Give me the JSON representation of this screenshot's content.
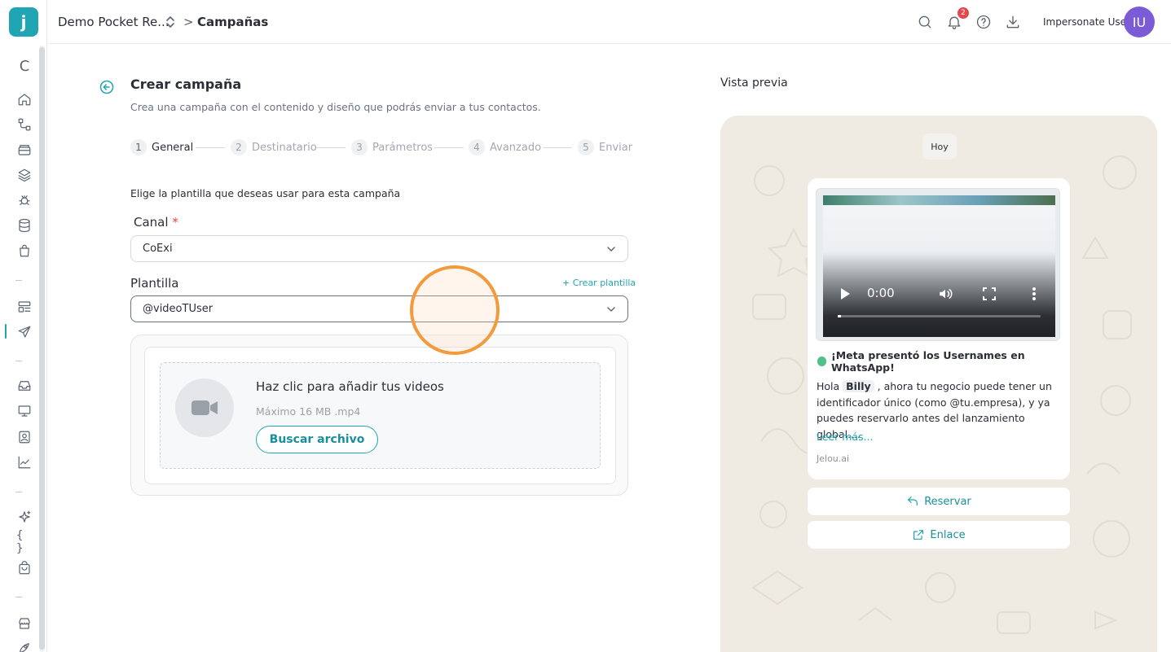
{
  "app": {
    "logo_letter": "j",
    "reload_glyph": "C"
  },
  "topbar": {
    "project": "Demo Pocket Re...",
    "separator": ">",
    "current_page": "Campañas",
    "notifications_count": "2",
    "user_name": "Impersonate User",
    "avatar_initials": "IU",
    "icons": [
      "search-icon",
      "bell-icon",
      "help-icon",
      "download-icon"
    ]
  },
  "sidebar": {
    "items": [
      "home-icon",
      "flow-icon",
      "archive-icon",
      "layers-icon",
      "bug-icon",
      "database-icon",
      "shopping-bag-icon",
      "layout-icon",
      "send-icon",
      "inbox-icon",
      "monitor-icon",
      "contact-icon",
      "chart-icon",
      "sparkles-icon",
      "braces-icon",
      "store-bag-icon",
      "shop-icon",
      "rocket-icon"
    ],
    "active": "send-icon",
    "braces_glyph": "{ }"
  },
  "form": {
    "title": "Crear campaña",
    "subtitle": "Crea una campaña con el contenido y diseño que podrás enviar a tus contactos.",
    "steps": [
      {
        "num": "1",
        "label": "General"
      },
      {
        "num": "2",
        "label": "Destinatario"
      },
      {
        "num": "3",
        "label": "Parámetros"
      },
      {
        "num": "4",
        "label": "Avanzado"
      },
      {
        "num": "5",
        "label": "Enviar"
      }
    ],
    "active_step": 1,
    "intro": "Elige la plantilla que deseas usar para esta campaña",
    "canal_label": "Canal",
    "required_mark": "*",
    "canal_value": "CoExi",
    "plantilla_label": "Plantilla",
    "crear_plantilla": "+ Crear plantilla",
    "plantilla_value": "@videoTUser",
    "upload": {
      "title": "Haz clic para añadir tus videos",
      "hint": "Máximo 16 MB .mp4",
      "button": "Buscar archivo"
    }
  },
  "preview": {
    "label": "Vista previa",
    "day": "Hoy",
    "video": {
      "time": "0:00",
      "progress": 0.0
    },
    "caption": "¡Meta presentó los Usernames en WhatsApp!",
    "body_pre": "Hola ",
    "body_name": "Billy",
    "body_post": " , ahora tu negocio puede tener un identificador único (como @tu.empresa), y ya puedes reservarlo antes del lanzamiento global....",
    "read_more": "Leer más...",
    "brand": "Jelou.ai",
    "buttons": [
      {
        "label": "Reservar",
        "icon": "reply-icon"
      },
      {
        "label": "Enlace",
        "icon": "external-link-icon"
      }
    ]
  },
  "colors": {
    "accent": "#1fa5b3",
    "avatar": "#7b5bd6",
    "badge": "#e5484d",
    "click_ring": "#f39a3c",
    "chat_bg": "#efeae2"
  }
}
